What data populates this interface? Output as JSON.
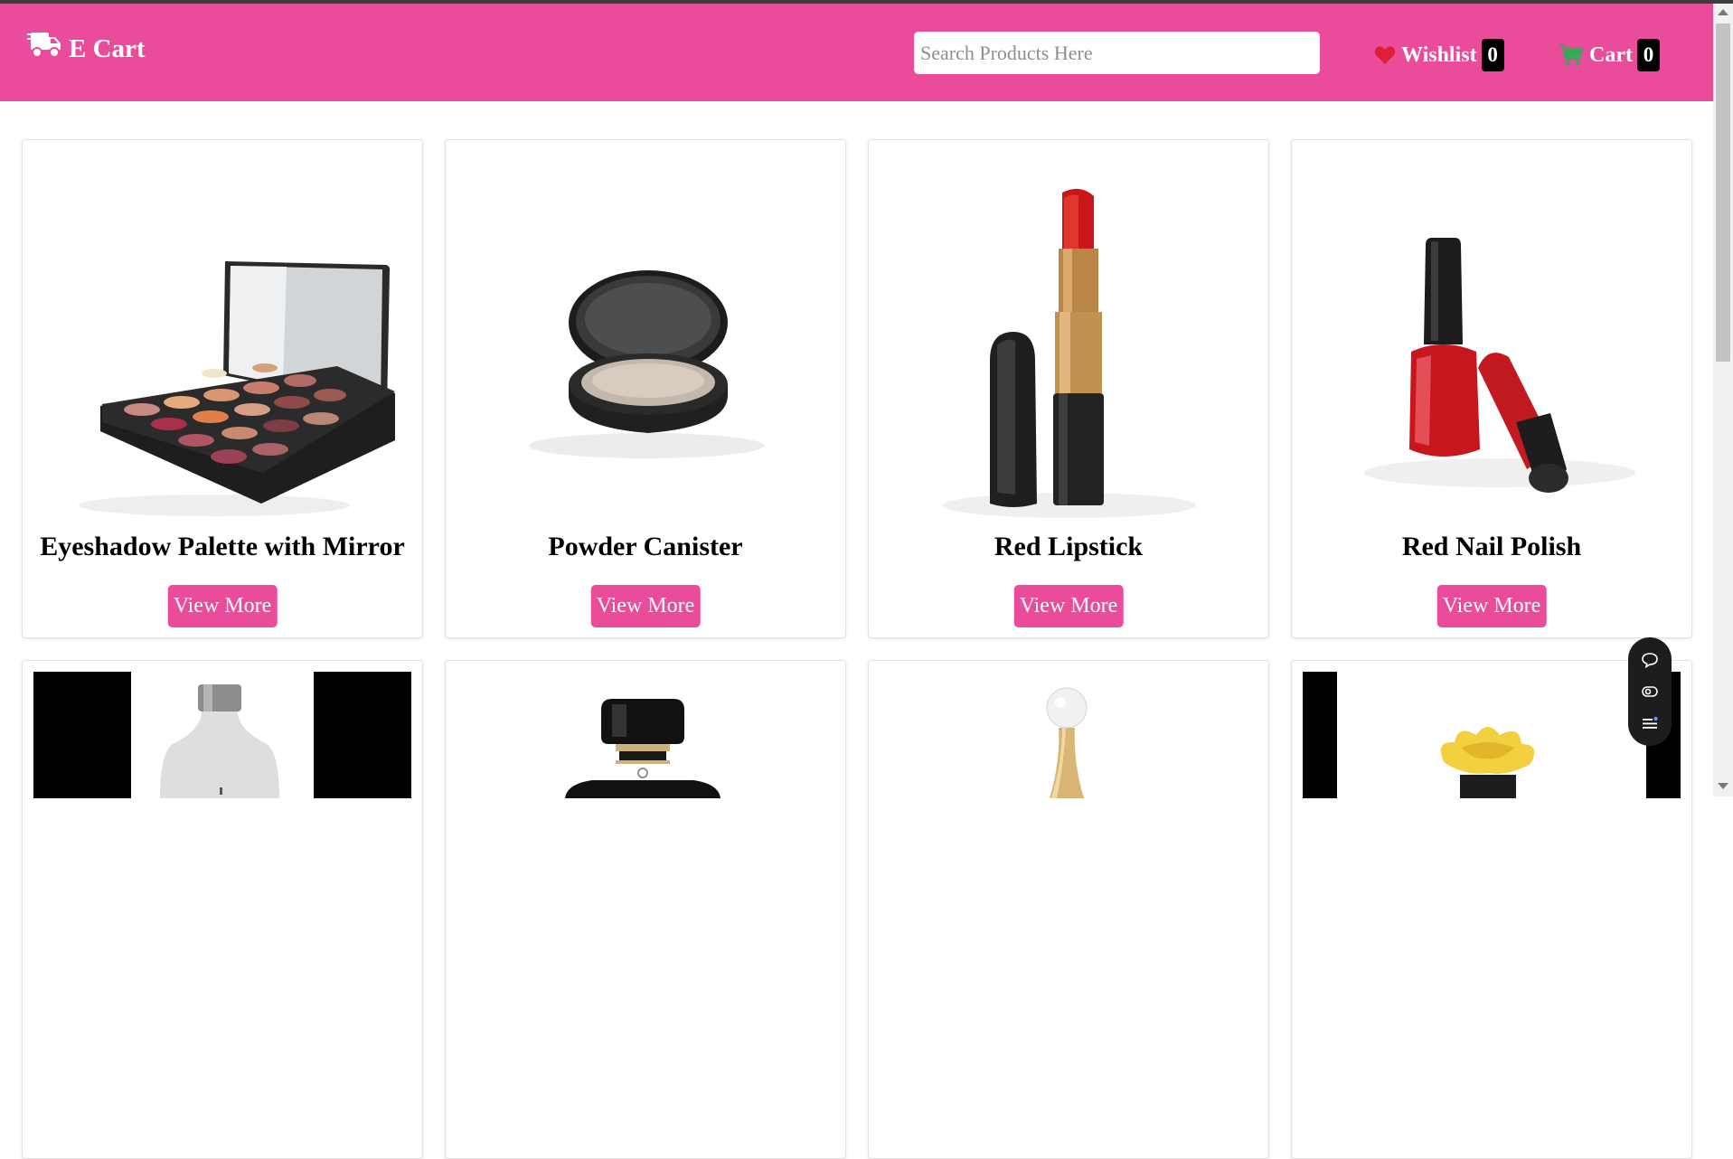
{
  "header": {
    "brand": "E Cart",
    "search_placeholder": "Search Products Here",
    "wishlist_label": "Wishlist",
    "wishlist_count": "0",
    "cart_label": "Cart",
    "cart_count": "0"
  },
  "colors": {
    "brand_pink": "#eb4b9b",
    "badge": "#000000",
    "wishlist_heart": "#e01e37",
    "cart_icon": "#3aa757"
  },
  "icons": {
    "brand": "delivery-truck-icon",
    "wishlist": "heart-icon",
    "cart": "shopping-cart-icon",
    "floating": [
      "chat-bubble-icon",
      "toggle-icon",
      "menu-list-icon"
    ]
  },
  "products": [
    {
      "name": "Eyeshadow Palette with Mirror",
      "button": "View More",
      "image": "eyeshadow-palette-image"
    },
    {
      "name": "Powder Canister",
      "button": "View More",
      "image": "powder-compact-image"
    },
    {
      "name": "Red Lipstick",
      "button": "View More",
      "image": "red-lipstick-image"
    },
    {
      "name": "Red Nail Polish",
      "button": "View More",
      "image": "red-nail-polish-image"
    },
    {
      "name": "",
      "button": "",
      "image": "perfume-bottle-frosted-image"
    },
    {
      "name": "",
      "button": "",
      "image": "perfume-bottle-black-image"
    },
    {
      "name": "",
      "button": "",
      "image": "perfume-bottle-gold-image"
    },
    {
      "name": "",
      "button": "",
      "image": "perfume-bottle-yellow-flower-image"
    }
  ]
}
